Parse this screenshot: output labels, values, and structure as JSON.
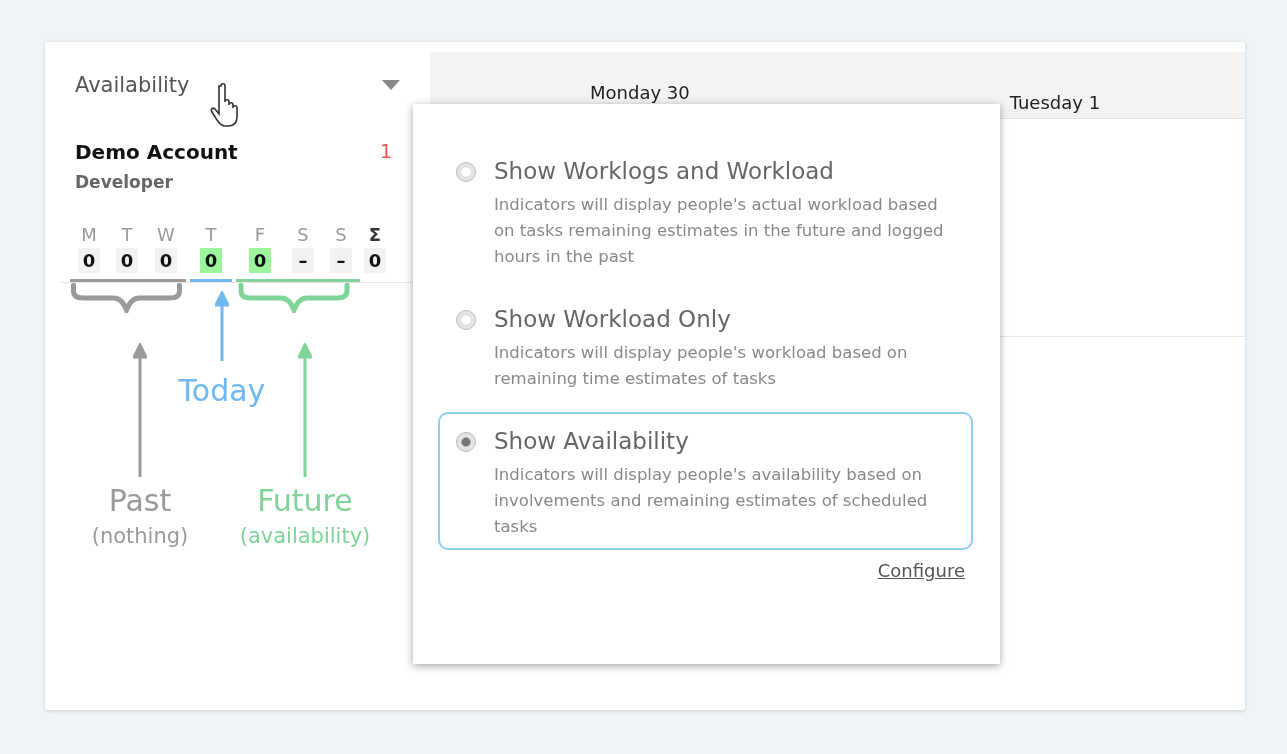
{
  "mode_select": {
    "value": "Availability"
  },
  "person": {
    "name": "Demo Account",
    "role": "Developer",
    "count": "1"
  },
  "days": [
    {
      "letter": "M",
      "value": "0",
      "kind": "past",
      "available": false
    },
    {
      "letter": "T",
      "value": "0",
      "kind": "past",
      "available": false
    },
    {
      "letter": "W",
      "value": "0",
      "kind": "past",
      "available": false
    },
    {
      "letter": "T",
      "value": "0",
      "kind": "today",
      "available": true
    },
    {
      "letter": "F",
      "value": "0",
      "kind": "future",
      "available": true
    },
    {
      "letter": "S",
      "value": "–",
      "kind": "future",
      "available": false
    },
    {
      "letter": "S",
      "value": "–",
      "kind": "future",
      "available": false
    }
  ],
  "total": {
    "label": "Σ",
    "value": "0"
  },
  "annotations": [
    {
      "kind": "past",
      "label": "Past",
      "note": "(nothing)",
      "color": "#9a9a9a"
    },
    {
      "kind": "today",
      "label": "Today",
      "color": "#6fb8f0"
    },
    {
      "kind": "future",
      "label": "Future",
      "note": "(availability)",
      "color": "#7fd49a"
    }
  ],
  "calendar": {
    "columns": [
      "Monday 30",
      "Tuesday 1"
    ]
  },
  "popup": {
    "options": [
      {
        "title": "Show Worklogs and Workload",
        "description": "Indicators will display people's actual workload based on tasks remaining estimates in the future and logged hours in the past",
        "selected": false
      },
      {
        "title": "Show Workload Only",
        "description": "Indicators will display people's workload based on remaining time estimates of tasks",
        "selected": false
      },
      {
        "title": "Show Availability",
        "description": "Indicators will display people's availability based on involvements and remaining estimates of scheduled tasks",
        "selected": true
      }
    ],
    "link": "Configure"
  }
}
